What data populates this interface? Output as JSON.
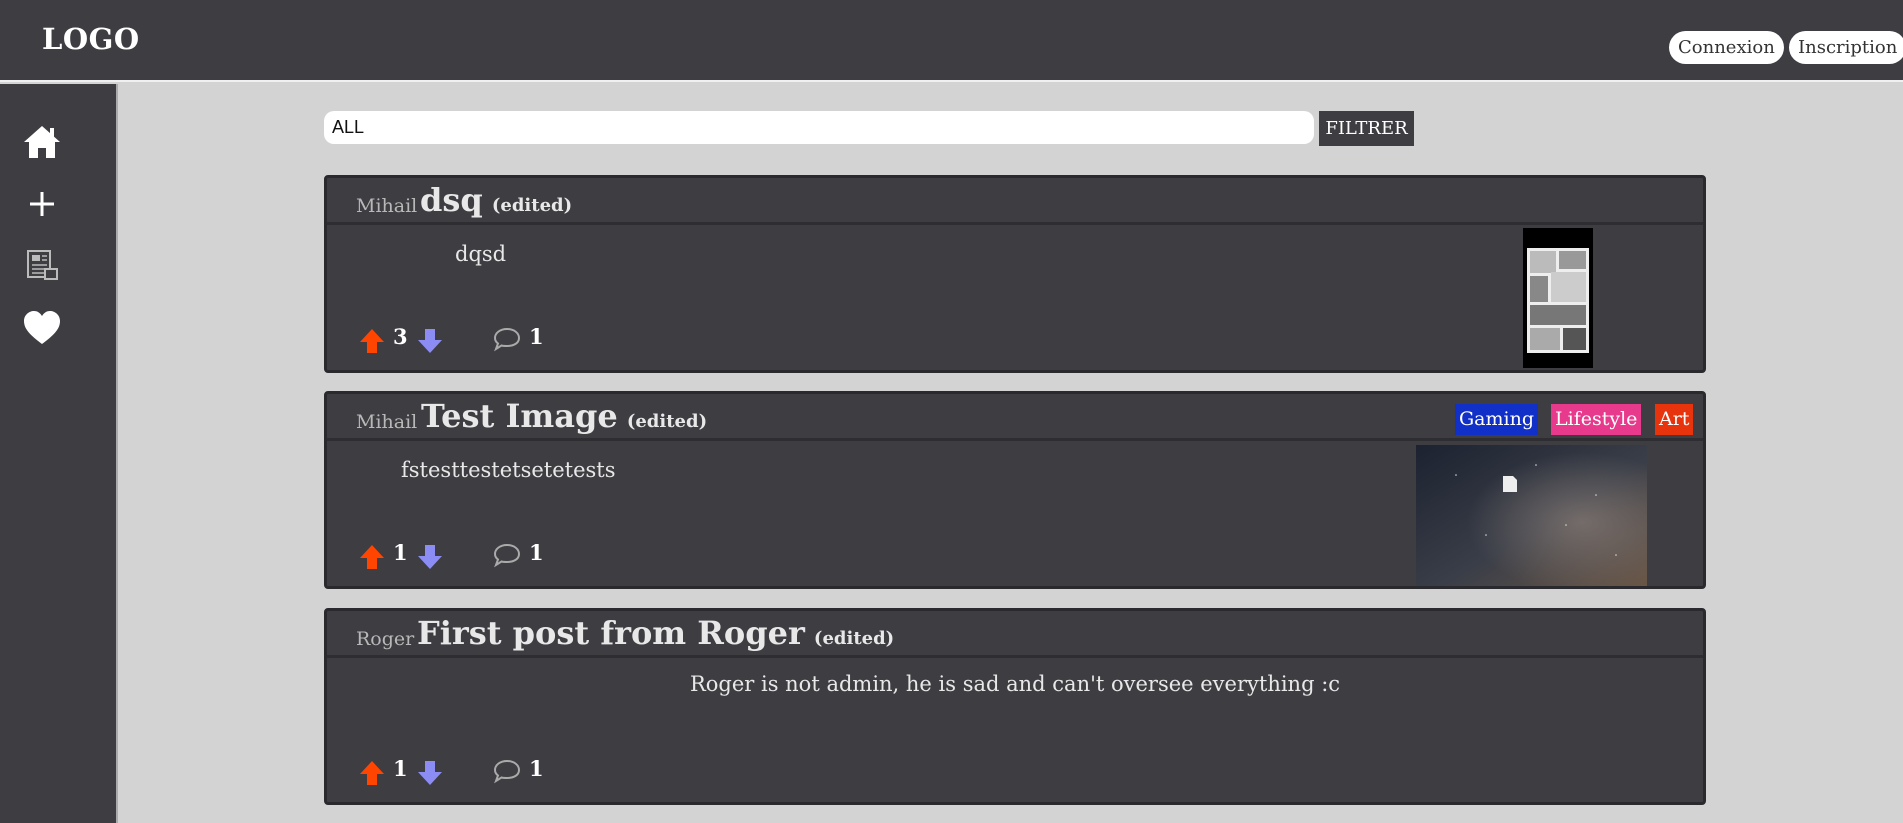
{
  "header": {
    "logo": "LOGO",
    "login_label": "Connexion",
    "signup_label": "Inscription"
  },
  "sidebar": {
    "items": [
      {
        "icon": "home-icon"
      },
      {
        "icon": "plus-icon"
      },
      {
        "icon": "newspaper-icon"
      },
      {
        "icon": "heart-icon"
      }
    ]
  },
  "filter": {
    "value": "ALL",
    "button_label": "FILTRER"
  },
  "posts": [
    {
      "author": "Mihail",
      "title": "dsq",
      "edited": "(edited)",
      "body": "dqsd",
      "votes": "3",
      "comments": "1",
      "tags": [],
      "thumbnail": "manga-page-image"
    },
    {
      "author": "Mihail",
      "title": "Test Image",
      "edited": "(edited)",
      "body": "fstesttestetsetetests",
      "votes": "1",
      "comments": "1",
      "tags": [
        {
          "label": "Gaming",
          "color": "#1030c8"
        },
        {
          "label": "Lifestyle",
          "color": "#e83a8c"
        },
        {
          "label": "Art",
          "color": "#e8340c"
        }
      ],
      "thumbnail": "night-sky-image"
    },
    {
      "author": "Roger",
      "title": "First post from Roger",
      "edited": "(edited)",
      "body": "Roger is not admin, he is sad and can't oversee everything :c",
      "votes": "1",
      "comments": "1",
      "tags": []
    }
  ],
  "colors": {
    "background": "#d3d3d3",
    "panel": "#3e3d42",
    "upvote": "#ff4500",
    "downvote": "#8c8cf5"
  }
}
